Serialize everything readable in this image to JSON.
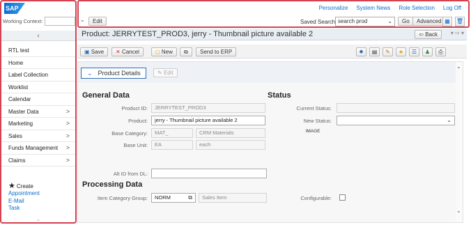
{
  "nav": {
    "logo": "SAP",
    "working_context_label": "Working Context:",
    "collapse_icon": "chevron-left",
    "items": [
      {
        "label": "RTL test",
        "chevron": ""
      },
      {
        "label": "Home",
        "chevron": ""
      },
      {
        "label": "Label Collection",
        "chevron": ""
      },
      {
        "label": "Worklist",
        "chevron": ""
      },
      {
        "label": "Calendar",
        "chevron": ""
      },
      {
        "label": "Master Data",
        "chevron": ">"
      },
      {
        "label": "Marketing",
        "chevron": ">"
      },
      {
        "label": "Sales",
        "chevron": ">"
      },
      {
        "label": "Funds Management",
        "chevron": ">"
      },
      {
        "label": "Claims",
        "chevron": ">"
      }
    ],
    "create_label": "Create",
    "create_links": [
      "Appointment",
      "E-Mail",
      "Task"
    ]
  },
  "top": {
    "links": [
      "Personalize",
      "System News",
      "Role Selection",
      "Log Off"
    ],
    "edit_label": "Edit",
    "saved_searches_label": "Saved Searches",
    "search_value": "search prod",
    "go_label": "Go",
    "advanced_label": "Advanced"
  },
  "page": {
    "title": "Product: JERRYTEST_PROD3, jerry - Thumbnail picture available 2",
    "back_label": "Back"
  },
  "toolbar": {
    "save_label": "Save",
    "cancel_label": "Cancel",
    "new_label": "New",
    "send_label": "Send to ERP"
  },
  "details": {
    "assignment_label": "Product Details",
    "edit_label": "Edit",
    "general_data_title": "General Data",
    "status_title": "Status",
    "processing_data_title": "Processing Data",
    "fields": {
      "product_id_label": "Product ID:",
      "product_id_value": "JERRYTEST_PROD3",
      "product_label": "Product:",
      "product_value": "jerry - Thumbnail picture available 2",
      "base_category_label": "Base Category:",
      "base_category_code": "MAT_",
      "base_category_desc": "CRM Materials",
      "base_unit_label": "Base Unit:",
      "base_unit_code": "EA",
      "base_unit_desc": "each",
      "alt_id_label": "Alt ID from DL:",
      "alt_id_value": "",
      "item_cat_label": "Item Category Group:",
      "item_cat_code": "NORM",
      "item_cat_desc": "Sales Item",
      "current_status_label": "Current Status:",
      "current_status_value": "",
      "new_status_label": "New Status:",
      "new_status_value": "",
      "image_label": "IMAGE",
      "configurable_label": "Configurable:"
    }
  },
  "colors": {
    "highlight_border": "#d6404f",
    "link": "#0a6ed1",
    "title_bar": "#e8eef4"
  }
}
